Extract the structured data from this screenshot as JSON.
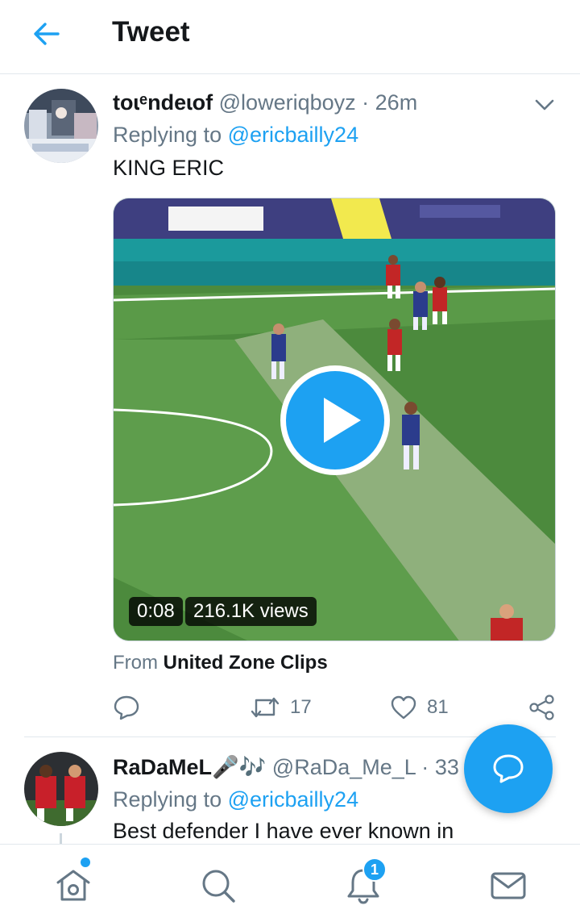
{
  "header": {
    "title": "Tweet",
    "back_icon": "arrow-left-icon"
  },
  "tweet": {
    "name": "toɩᵉndeɩof",
    "handle": "@loweriqboyz",
    "separator": "·",
    "time": "26m",
    "replying_label": "Replying to",
    "replying_to": "@ericbailly24",
    "text": "KING ERIC",
    "video": {
      "duration": "0:08",
      "views": "216.1K views"
    },
    "from_label": "From",
    "from_source": "United Zone Clips",
    "retweets": "17",
    "likes": "81"
  },
  "reply": {
    "name": "RaDaMeL🎤🎶",
    "handle": "@RaDa_Me_L",
    "separator": "·",
    "time": "33",
    "replying_label": "Replying to",
    "replying_to": "@ericbailly24",
    "text": "Best defender I have ever known in"
  },
  "nav": {
    "items": [
      "home-icon",
      "search-icon",
      "notifications-icon",
      "messages-icon"
    ],
    "notification_count": "1"
  },
  "colors": {
    "accent": "#1da1f2",
    "muted": "#657786",
    "text": "#14171a",
    "pitch_green": "#4c8a3d"
  }
}
